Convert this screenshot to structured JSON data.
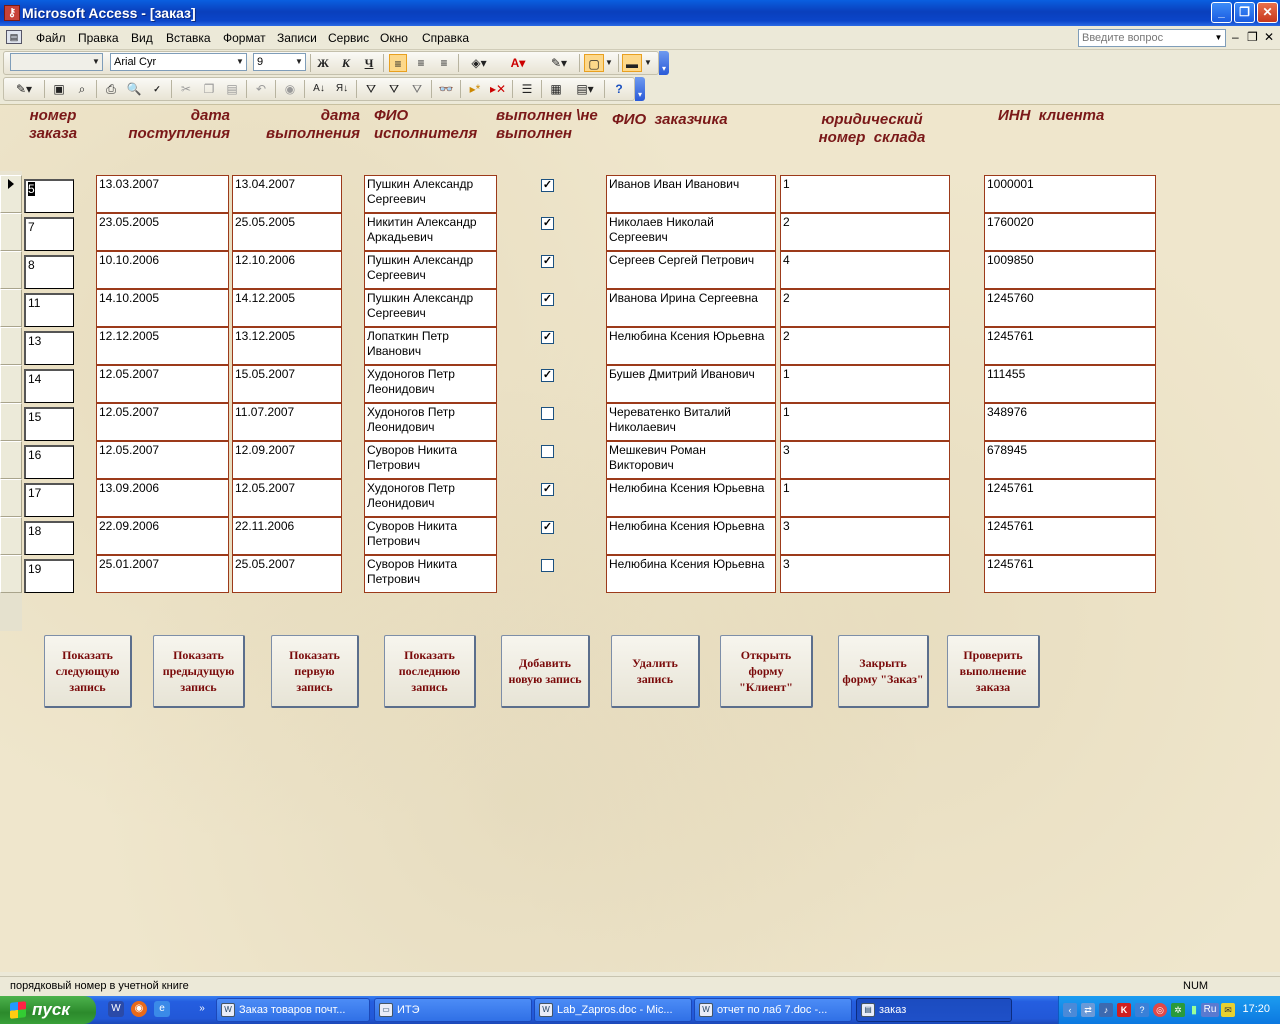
{
  "window": {
    "title": "Microsoft Access - [заказ]",
    "app_icon": "access-key-icon"
  },
  "menu": {
    "items": [
      "Файл",
      "Правка",
      "Вид",
      "Вставка",
      "Формат",
      "Записи",
      "Сервис",
      "Окно",
      "Справка"
    ],
    "ask_placeholder": "Введите вопрос"
  },
  "format_toolbar": {
    "object_combo": "",
    "font": "Arial Cyr",
    "size": "9"
  },
  "form": {
    "headers": {
      "order_no": "номер\nзаказа",
      "received": "дата\nпоступления",
      "done_date": "дата\nвыполнения",
      "executor": "ФИО\nисполнителя",
      "completed": "выполнен \\не\nвыполнен",
      "customer": "ФИО  заказчика",
      "warehouse": "юридический\nномер  склада",
      "inn": "ИНН  клиента"
    },
    "rows": [
      {
        "no": "5",
        "received": "13.03.2007",
        "done": "13.04.2007",
        "executor": "Пушкин Александр\nСергеевич",
        "completed": true,
        "customer": "Иванов Иван Иванович",
        "warehouse": "1",
        "inn": "1000001"
      },
      {
        "no": "7",
        "received": "23.05.2005",
        "done": "25.05.2005",
        "executor": "Никитин Александр\nАркадьевич",
        "completed": true,
        "customer": "Николаев Николай\nСергеевич",
        "warehouse": "2",
        "inn": "1760020"
      },
      {
        "no": "8",
        "received": "10.10.2006",
        "done": "12.10.2006",
        "executor": "Пушкин Александр\nСергеевич",
        "completed": true,
        "customer": "Сергеев Сергей Петрович",
        "warehouse": "4",
        "inn": "1009850"
      },
      {
        "no": "11",
        "received": "14.10.2005",
        "done": "14.12.2005",
        "executor": "Пушкин Александр\nСергеевич",
        "completed": true,
        "customer": "Иванова Ирина Сергеевна",
        "warehouse": "2",
        "inn": "1245760"
      },
      {
        "no": "13",
        "received": "12.12.2005",
        "done": "13.12.2005",
        "executor": "Лопаткин Петр\nИванович",
        "completed": true,
        "customer": "Нелюбина Ксения Юрьевна",
        "warehouse": "2",
        "inn": "1245761"
      },
      {
        "no": "14",
        "received": "12.05.2007",
        "done": "15.05.2007",
        "executor": "Худоногов Петр\nЛеонидович",
        "completed": true,
        "customer": "Бушев Дмитрий Иванович",
        "warehouse": "1",
        "inn": "111455"
      },
      {
        "no": "15",
        "received": "12.05.2007",
        "done": "11.07.2007",
        "executor": "Худоногов Петр\nЛеонидович",
        "completed": false,
        "customer": "Череватенко Виталий\nНиколаевич",
        "warehouse": "1",
        "inn": "348976"
      },
      {
        "no": "16",
        "received": "12.05.2007",
        "done": "12.09.2007",
        "executor": "Суворов Никита\nПетрович",
        "completed": false,
        "customer": "Мешкевич Роман\nВикторович",
        "warehouse": "3",
        "inn": "678945"
      },
      {
        "no": "17",
        "received": "13.09.2006",
        "done": "12.05.2007",
        "executor": "Худоногов Петр\nЛеонидович",
        "completed": true,
        "customer": "Нелюбина Ксения Юрьевна",
        "warehouse": "1",
        "inn": "1245761"
      },
      {
        "no": "18",
        "received": "22.09.2006",
        "done": "22.11.2006",
        "executor": "Суворов Никита\nПетрович",
        "completed": true,
        "customer": "Нелюбина Ксения Юрьевна",
        "warehouse": "3",
        "inn": "1245761"
      },
      {
        "no": "19",
        "received": "25.01.2007",
        "done": "25.05.2007",
        "executor": "Суворов Никита\nПетрович",
        "completed": false,
        "customer": "Нелюбина Ксения Юрьевна",
        "warehouse": "3",
        "inn": "1245761"
      }
    ],
    "buttons": [
      "Показать\nследующую\nзапись",
      "Показать\nпредыдущую\nзапись",
      "Показать\nпервую\nзапись",
      "Показать\nпоследнюю\nзапись",
      "Добавить\nновую запись",
      "Удалить\nзапись",
      "Открыть\nформу\n\"Клиент\"",
      "Закрыть\nформу \"Заказ\"",
      "Проверить\nвыполнение\nзаказа"
    ]
  },
  "status": {
    "text": "порядковый номер в учетной книге",
    "indicator": "NUM"
  },
  "taskbar": {
    "start": "пуск",
    "tasks": [
      "Заказ товаров почт...",
      "ИТЭ",
      "Lab_Zapros.doc - Mic...",
      "отчет по лаб 7.doc -...",
      "заказ"
    ],
    "lang": "Ru",
    "clock": "17:20"
  },
  "colors": {
    "header_text": "#7a1818",
    "field_border": "#9c3a1a",
    "button_text": "#7a0a0a",
    "form_bg": "#efe6cc"
  }
}
